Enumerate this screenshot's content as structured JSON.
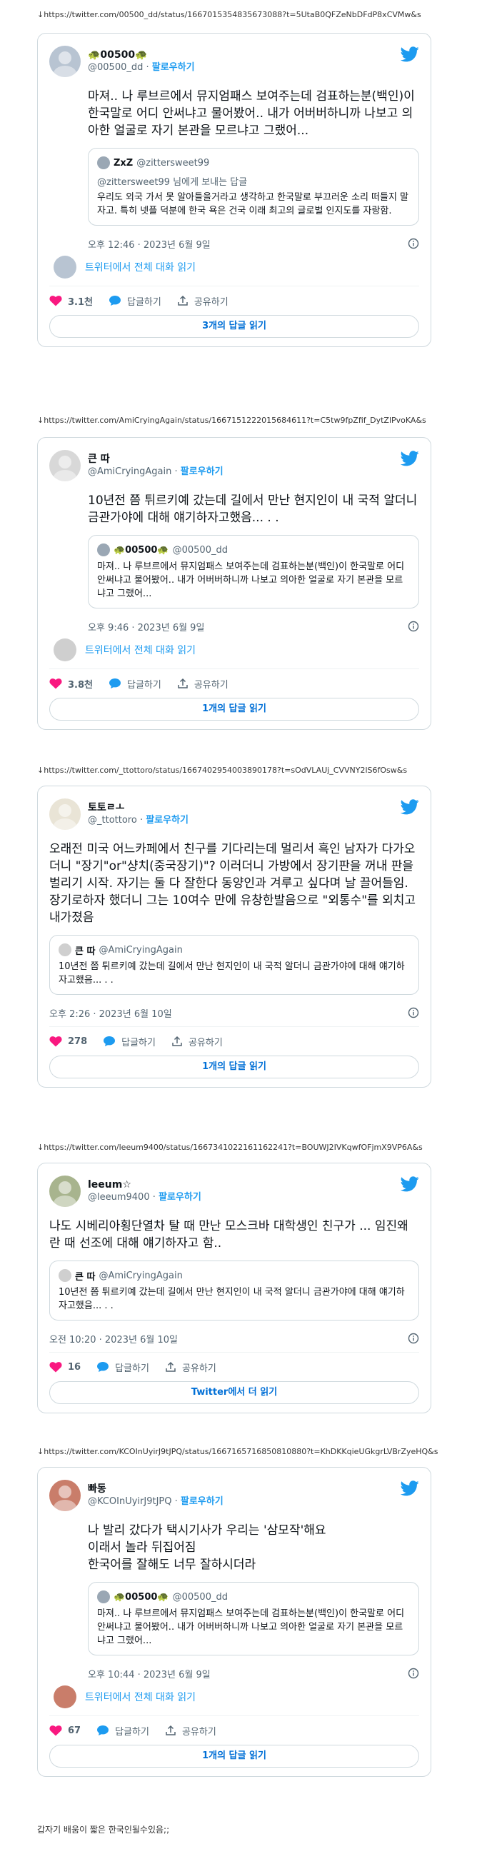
{
  "tweets": [
    {
      "url": "↓https://twitter.com/00500_dd/status/1667015354835673088?t=5UtaB0QFZeNbDFdP8xCVMw&s",
      "name": "🐢00500🐢",
      "handle": "@00500_dd",
      "follow": "팔로우하기",
      "text": "마져.. 나 루브르에서 뮤지엄패스 보여주는데 검표하는분(백인)이 한국말로 어디 안써냐고 물어봤어.. 내가 어버버하니까 나보고 의아한 얼굴로 자기 본관을 모르냐고 그랬어...",
      "quote": {
        "name": "ZxZ",
        "handle": "@zittersweet99",
        "reply": "@zittersweet99 님에게 보내는 답글",
        "text": "우리도 외국 가서 못 알아들을거라고 생각하고 한국말로 부끄러운 소리 떠들지 말자고. 특히 넷플 덕분에 한국 욕은 건국 이래 최고의 글로벌 인지도를 자랑함."
      },
      "time": "오후 12:46 · 2023년 6월 9일",
      "thread": "트위터에서 전체 대화 읽기",
      "likes": "3.1천",
      "reply_label": "답글하기",
      "share_label": "공유하기",
      "read_more": "3개의 답글 읽기"
    },
    {
      "url": "↓https://twitter.com/AmiCryingAgain/status/1667151222015684611?t=C5tw9fpZfif_DytZlPvoKA&s",
      "name": "큰 따",
      "handle": "@AmiCryingAgain",
      "follow": "팔로우하기",
      "text": "10년전 쯤 튀르키예 갔는데 길에서 만난 현지인이 내 국적 알더니 금관가야에 대해 얘기하자고했음... . .",
      "quote": {
        "name": "🐢00500🐢",
        "handle": "@00500_dd",
        "reply": "",
        "text": "마져.. 나 루브르에서 뮤지엄패스 보여주는데 검표하는분(백인)이 한국말로 어디 안써냐고 물어봤어.. 내가 어버버하니까 나보고 의아한 얼굴로 자기 본관을 모르냐고 그랬어..."
      },
      "time": "오후 9:46 · 2023년 6월 9일",
      "thread": "트위터에서 전체 대화 읽기",
      "likes": "3.8천",
      "reply_label": "답글하기",
      "share_label": "공유하기",
      "read_more": "1개의 답글 읽기"
    },
    {
      "url": "↓https://twitter.com/_ttottoro/status/1667402954003890178?t=sOdVLAUj_CVVNY2lS6fOsw&s",
      "name": "토토ㄹㅗ",
      "handle": "@_ttottoro",
      "follow": "팔로우하기",
      "text": "오래전 미국 어느카페에서 친구를 기다리는데 멀리서 흑인 남자가 다가오더니 \"장기\"or\"샹치(중국장기)\"? 이러더니 가방에서 장기판을 꺼내 판을 벌리기 시작. 자기는 둘 다 잘한다 동양인과 겨루고 싶다며 날 끌어들임. 장기로하자 했더니 그는 10여수 만에 유창한발음으로 \"외통수\"를 외치고 내가졌음",
      "quote": {
        "name": "큰 따",
        "handle": "@AmiCryingAgain",
        "reply": "",
        "text": "10년전 쯤 튀르키예 갔는데 길에서 만난 현지인이 내 국적 알더니 금관가야에 대해 얘기하자고했음... . ."
      },
      "time": "오후 2:26 · 2023년 6월 10일",
      "thread": "",
      "likes": "278",
      "reply_label": "답글하기",
      "share_label": "공유하기",
      "read_more": "1개의 답글 읽기"
    },
    {
      "url": "↓https://twitter.com/leeum9400/status/1667341022161162241?t=BOUWJ2IVKqwfOFjmX9VP6A&s",
      "name": "leeum☆",
      "handle": "@leeum9400",
      "follow": "팔로우하기",
      "text": "나도 시베리아횡단열차 탈 때 만난 모스크바 대학생인 친구가 ... 임진왜란 때 선조에 대해 얘기하자고 함..",
      "quote": {
        "name": "큰 따",
        "handle": "@AmiCryingAgain",
        "reply": "",
        "text": "10년전 쯤 튀르키예 갔는데 길에서 만난 현지인이 내 국적 알더니 금관가야에 대해 얘기하자고했음... . ."
      },
      "time": "오전 10:20 · 2023년 6월 10일",
      "thread": "",
      "likes": "16",
      "reply_label": "답글하기",
      "share_label": "공유하기",
      "read_more": "Twitter에서 더 읽기"
    },
    {
      "url": "↓https://twitter.com/KCOInUyirJ9tJPQ/status/1667165716850810880?t=KhDKKqieUGkgrLVBrZyeHQ&s",
      "name": "빠동",
      "handle": "@KCOInUyirJ9tJPQ",
      "follow": "팔로우하기",
      "text": "나 발리 갔다가 택시기사가 우리는 '삼모작'해요\n이래서 놀라 뒤집어짐\n한국어를 잘해도 너무 잘하시더라",
      "quote": {
        "name": "🐢00500🐢",
        "handle": "@00500_dd",
        "reply": "",
        "text": "마져.. 나 루브르에서 뮤지엄패스 보여주는데 검표하는분(백인)이 한국말로 어디 안써냐고 물어봤어.. 내가 어버버하니까 나보고 의아한 얼굴로 자기 본관을 모르냐고 그랬어..."
      },
      "time": "오후 10:44 · 2023년 6월 9일",
      "thread": "트위터에서 전체 대화 읽기",
      "likes": "67",
      "reply_label": "답글하기",
      "share_label": "공유하기",
      "read_more": "1개의 답글 읽기"
    }
  ],
  "footer": "갑자기 배움이 짧은 한국인될수있음;;",
  "colors": {
    "accent": "#1d9bf0",
    "like": "#f91880",
    "border": "#cfd9de"
  },
  "icons": [
    "twitter-bird-icon",
    "heart-icon",
    "reply-bubble-icon",
    "share-icon",
    "info-icon"
  ]
}
